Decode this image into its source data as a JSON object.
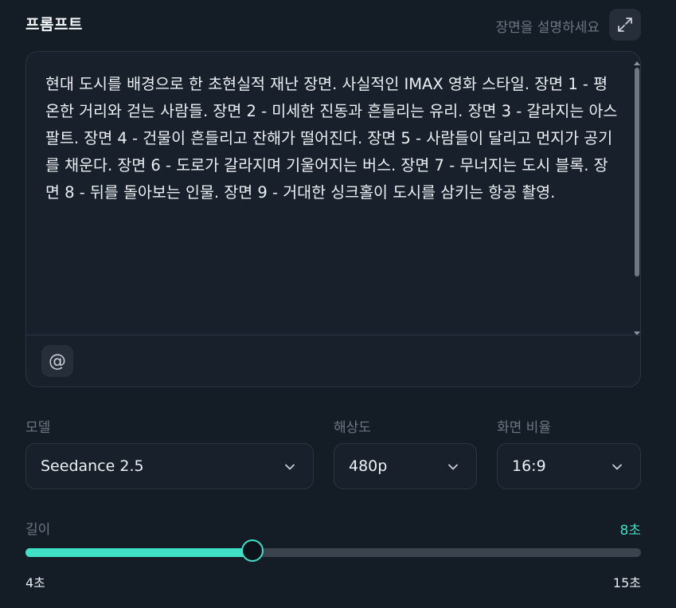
{
  "prompt": {
    "title": "프롬프트",
    "hint": "장면을 설명하세요",
    "text": "현대 도시를 배경으로 한 초현실적 재난 장면. 사실적인 IMAX 영화 스타일. 장면 1 - 평온한 거리와 걷는 사람들. 장면 2 - 미세한 진동과 흔들리는 유리. 장면 3 - 갈라지는 아스팔트. 장면 4 - 건물이 흔들리고 잔해가 떨어진다. 장면 5 - 사람들이 달리고 먼지가 공기를 채운다. 장면 6 - 도로가 갈라지며 기울어지는 버스. 장면 7 - 무너지는 도시 블록. 장면 8 - 뒤를 돌아보는 인물. 장면 9 - 거대한 싱크홀이 도시를 삼키는 항공 촬영.",
    "mention_symbol": "@",
    "expand_icon": "expand-icon"
  },
  "settings": {
    "model": {
      "label": "모델",
      "value": "Seedance 2.5"
    },
    "resolution": {
      "label": "해상도",
      "value": "480p"
    },
    "aspect": {
      "label": "화면 비율",
      "value": "16:9"
    }
  },
  "length": {
    "label": "길이",
    "value_label": "8초",
    "value": 8,
    "min": 4,
    "max": 15,
    "min_label": "4초",
    "max_label": "15초"
  },
  "colors": {
    "accent": "#3fe0c5",
    "background": "#141c26"
  }
}
